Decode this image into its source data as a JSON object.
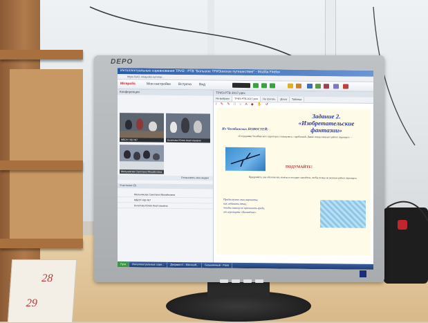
{
  "monitor": {
    "brand": "DEPO"
  },
  "browser": {
    "title": "Интеллектуальные соревнования ТРИЗ - РТВ \"Большое ТРИЗовское путешествие\" - Mozilla Firefox",
    "url": "https://s41.mirapolis.ru/mira/...",
    "nav": {
      "logo": "Mirapolis",
      "items": [
        "Мои настройки",
        "Встреча",
        "Вид"
      ]
    }
  },
  "left_pane": {
    "header": "Конференция",
    "videos": [
      {
        "label": "МБОУ НШ №7"
      },
      {
        "label": "Кочетова Юлия Анатольевна"
      },
      {
        "label": "Мельникова Светлана Михайловна"
      }
    ],
    "stop_label": "Остановить мое видео",
    "participants_header": "Участники (3)",
    "participants": [
      {
        "name": "Мельникова Светлана Михайловна"
      },
      {
        "name": "МБОУ НШ №7"
      },
      {
        "name": "Кочетова Юлия Анатольевна"
      }
    ]
  },
  "right_pane": {
    "header": "ТРИЗ-РТВ 2017.pptx",
    "tabs": [
      "Не выбрано",
      "ТРИЗ-РТВ 2017.pptx",
      "Не трогать",
      "Доска",
      "Таблица"
    ],
    "tools": "/ ✎ ✎ □ ○ A ◆ ✋ ↺",
    "slide": {
      "title": "Задание 2. «Изобретательские фантазии»",
      "from": "Из Челябинских НОВОСТЕЙ:",
      "lead": "«Сотрудники Челябинского аэропорта столкнулись с проблемой. Дикие птицы мешают работе аэропорта — ",
      "think": "ПОДУМАЙТЕ!",
      "body": "Придумайте, как обезопасить взлёты и посадки самолётов, чтобы птицы не мешали работе аэропорта.",
      "list": [
        "Предложите свои варианты,",
        "как избавить птиц,",
        "чтобы никому не причинить вреда,",
        "от аэропорта «Баландино»"
      ]
    }
  },
  "taskbar": {
    "items": [
      "Пуск",
      "Интеллектуальные соре...",
      "Документ1 - Microsoft...",
      "Безымянный - Paint"
    ]
  },
  "desk": {
    "calendar_top": "28",
    "calendar_bottom": "29"
  }
}
